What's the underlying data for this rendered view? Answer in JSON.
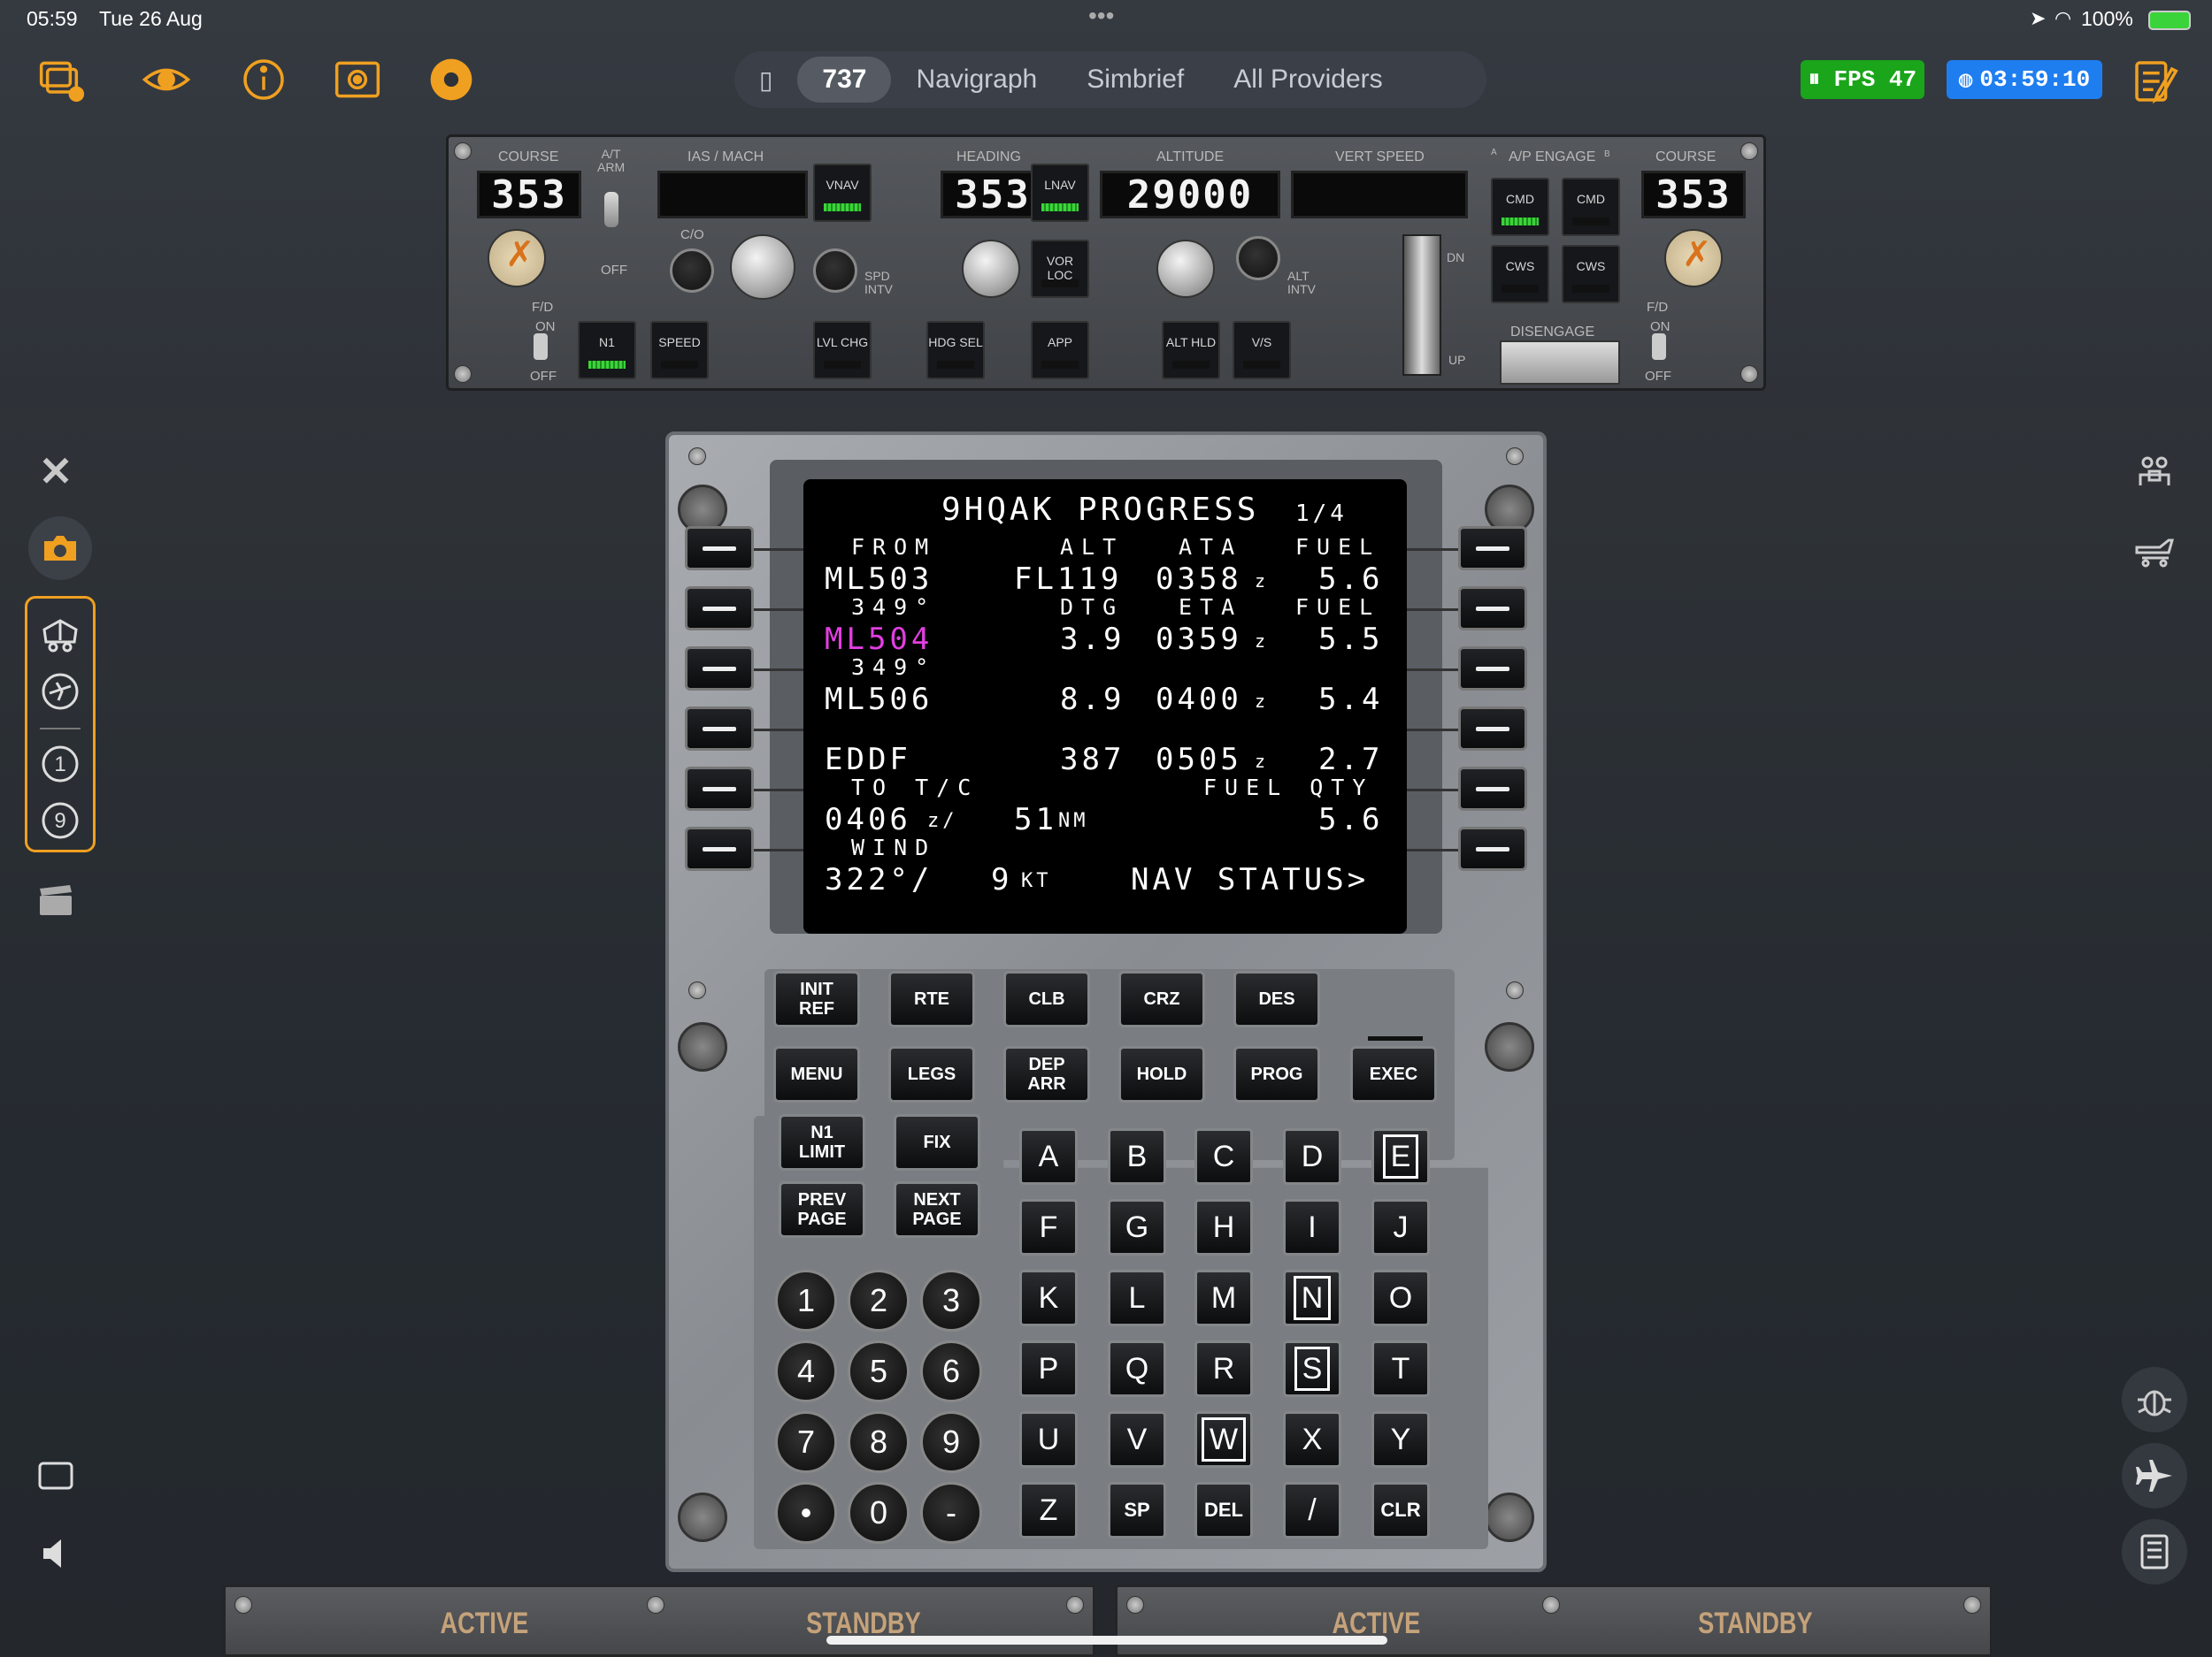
{
  "status": {
    "time": "05:59",
    "date": "Tue 26 Aug",
    "battery": "100%",
    "dots": "•••"
  },
  "segments": [
    {
      "label": "737",
      "active": true
    },
    {
      "label": "Navigraph"
    },
    {
      "label": "Simbrief"
    },
    {
      "label": "All Providers"
    }
  ],
  "fps": {
    "label": "FPS",
    "value": "47"
  },
  "clock": "03:59:10",
  "mcp": {
    "labels": {
      "course_l": "COURSE",
      "at_arm": "A/T\nARM",
      "ias_mach": "IAS / MACH",
      "heading": "HEADING",
      "altitude": "ALTITUDE",
      "vert_speed": "VERT SPEED",
      "ap_engage": "A/P ENGAGE",
      "course_r": "COURSE",
      "co": "C/O",
      "spd_intv": "SPD\nINTV",
      "alt_intv": "ALT\nINTV",
      "fd_l": "F/D",
      "on_l": "ON",
      "off_l": "OFF",
      "off_at": "OFF",
      "fd_r": "F/D",
      "on_r": "ON",
      "off_r": "OFF",
      "dn": "DN",
      "up": "UP",
      "a": "A",
      "b": "B",
      "disengage": "DISENGAGE"
    },
    "course_left": "353",
    "heading": "353",
    "altitude": "29000",
    "course_right": "353",
    "buttons": {
      "vnav": "VNAV",
      "lnav": "LNAV",
      "vor_loc": "VOR LOC",
      "cmd_a": "CMD",
      "cmd_b": "CMD",
      "cws_a": "CWS",
      "cws_b": "CWS",
      "n1": "N1",
      "speed": "SPEED",
      "lvl_chg": "LVL CHG",
      "hdg_sel": "HDG SEL",
      "app": "APP",
      "alt_hld": "ALT HLD",
      "vs": "V/S"
    }
  },
  "cdu": {
    "title": "9HQAK PROGRESS",
    "page": "1/4",
    "h1": {
      "from": "FROM",
      "alt": "ALT",
      "ata": "ATA",
      "fuel": "FUEL"
    },
    "r1": {
      "wpt": "ML503",
      "alt": "FL119",
      "ata": "0358",
      "z": "z",
      "fuel": "5.6"
    },
    "h2": {
      "crs": "349°",
      "dtg": "DTG",
      "eta": "ETA",
      "fuel": "FUEL"
    },
    "r2": {
      "wpt": "ML504",
      "dtg": "3.9",
      "eta": "0359",
      "z": "z",
      "fuel": "5.5"
    },
    "h3": {
      "crs": "349°"
    },
    "r3": {
      "wpt": "ML506",
      "dtg": "8.9",
      "eta": "0400",
      "z": "z",
      "fuel": "5.4"
    },
    "r4": {
      "wpt": "EDDF",
      "dtg": "387",
      "eta": "0505",
      "z": "z",
      "fuel": "2.7"
    },
    "h5": {
      "totc": "TO T/C",
      "fuelqty": "FUEL QTY"
    },
    "r5": {
      "time": "0406",
      "z": "z/",
      "dist": "51",
      "nm": "NM",
      "qty": "5.6"
    },
    "h6": {
      "wind": "WIND"
    },
    "r6": {
      "wind": "322°/",
      "kt_val": "9",
      "kt": "KT",
      "nav": "NAV STATUS>"
    },
    "function_keys": [
      "INIT\nREF",
      "RTE",
      "CLB",
      "CRZ",
      "DES",
      "MENU",
      "LEGS",
      "DEP\nARR",
      "HOLD",
      "PROG",
      "EXEC",
      "N1\nLIMIT",
      "FIX",
      "PREV\nPAGE",
      "NEXT\nPAGE"
    ],
    "alpha_keys": [
      "A",
      "B",
      "C",
      "D",
      "E",
      "F",
      "G",
      "H",
      "I",
      "J",
      "K",
      "L",
      "M",
      "N",
      "O",
      "P",
      "Q",
      "R",
      "S",
      "T",
      "U",
      "V",
      "W",
      "X",
      "Y",
      "Z",
      "SP",
      "DEL",
      "/",
      "CLR"
    ],
    "num_keys": [
      "1",
      "2",
      "3",
      "4",
      "5",
      "6",
      "7",
      "8",
      "9",
      "•",
      "0",
      "-"
    ]
  },
  "radio": {
    "active1": "ACTIVE",
    "standby1": "STANDBY",
    "active2": "ACTIVE",
    "standby2": "STANDBY"
  },
  "colors": {
    "accent": "#f0a020",
    "fps_bg": "#1aa51a",
    "clock_bg": "#1e7ef0",
    "magenta": "#e23ee2"
  }
}
